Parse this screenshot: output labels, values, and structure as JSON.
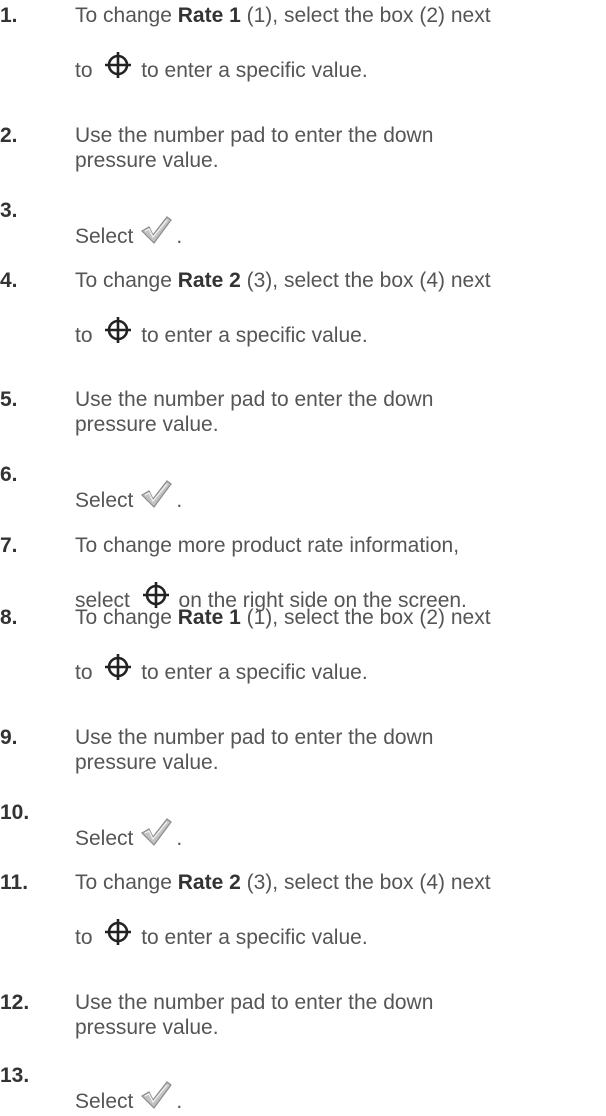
{
  "steps": [
    {
      "num": "1.",
      "pre": "To change ",
      "bold": "Rate 1",
      "post": " (1), select the box (2) next",
      "pre2": "to ",
      "icon": "crosshair-icon",
      "post2": " to enter a specific value."
    },
    {
      "num": "2.",
      "line1": "Use the number pad to enter the down",
      "line2": "pressure value."
    },
    {
      "num": "3.",
      "select": "Select",
      "icon": "checkmark-icon",
      "end": "."
    },
    {
      "num": "4.",
      "pre": "To change ",
      "bold": "Rate 2",
      "post": " (3), select the box (4) next",
      "pre2": "to ",
      "icon": "crosshair-icon",
      "post2": " to enter a specific value."
    },
    {
      "num": "5.",
      "line1": "Use the number pad to enter the down",
      "line2": "pressure value."
    },
    {
      "num": "6.",
      "select": "Select",
      "icon": "checkmark-icon",
      "end": "."
    },
    {
      "num": "7.",
      "line1": "To change more product rate information,",
      "pre2": "select ",
      "icon": "crosshair-icon",
      "post2": " on the right side on the screen."
    },
    {
      "num": "8.",
      "pre": "To change ",
      "bold": "Rate 1",
      "post": " (1), select the box (2) next",
      "pre2": "to ",
      "icon": "crosshair-icon",
      "post2": " to enter a specific value."
    },
    {
      "num": "9.",
      "line1": "Use the number pad to enter the down",
      "line2": "pressure value."
    },
    {
      "num": "10.",
      "select": "Select",
      "icon": "checkmark-icon",
      "end": "."
    },
    {
      "num": "11.",
      "pre": "To change ",
      "bold": "Rate 2",
      "post": " (3), select the box (4) next",
      "pre2": "to ",
      "icon": "crosshair-icon",
      "post2": " to enter a specific value."
    },
    {
      "num": "12.",
      "line1": "Use the number pad to enter the down",
      "line2": "pressure value."
    },
    {
      "num": "13.",
      "select": "Select",
      "icon": "checkmark-icon",
      "end": "."
    }
  ]
}
